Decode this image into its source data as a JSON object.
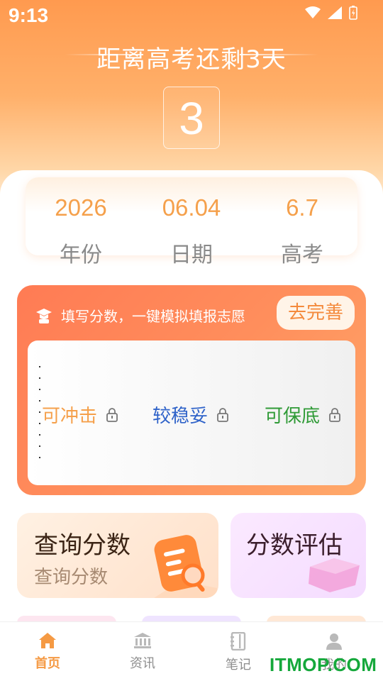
{
  "status": {
    "time": "9:13"
  },
  "countdown": {
    "title": "距离高考还剩3天",
    "days": "3"
  },
  "date_info": [
    {
      "value": "2026",
      "label": "年份"
    },
    {
      "value": "06.04",
      "label": "日期"
    },
    {
      "value": "6.7",
      "label": "高考"
    }
  ],
  "volunteer": {
    "prompt": "填写分数，一键模拟填报志愿",
    "button": "去完善",
    "chances": [
      {
        "label": "可冲击",
        "color": "#f5a04b"
      },
      {
        "label": "较稳妥",
        "color": "#2e62c9"
      },
      {
        "label": "可保底",
        "color": "#2f9a36"
      }
    ]
  },
  "tiles": {
    "query": {
      "title": "查询分数",
      "subtitle": "查询分数"
    },
    "evaluate": {
      "title": "分数评估"
    }
  },
  "tabbar": [
    {
      "label": "首页",
      "icon": "home-icon",
      "active": true
    },
    {
      "label": "资讯",
      "icon": "bank-icon",
      "active": false
    },
    {
      "label": "笔记",
      "icon": "notebook-icon",
      "active": false
    },
    {
      "label": "我的",
      "icon": "user-icon",
      "active": false
    }
  ],
  "watermark": "ITMOP.COM",
  "colors": {
    "accent": "#f59a44",
    "hero_top": "#ff9a4f",
    "card_orange": "#ff8e5c"
  }
}
